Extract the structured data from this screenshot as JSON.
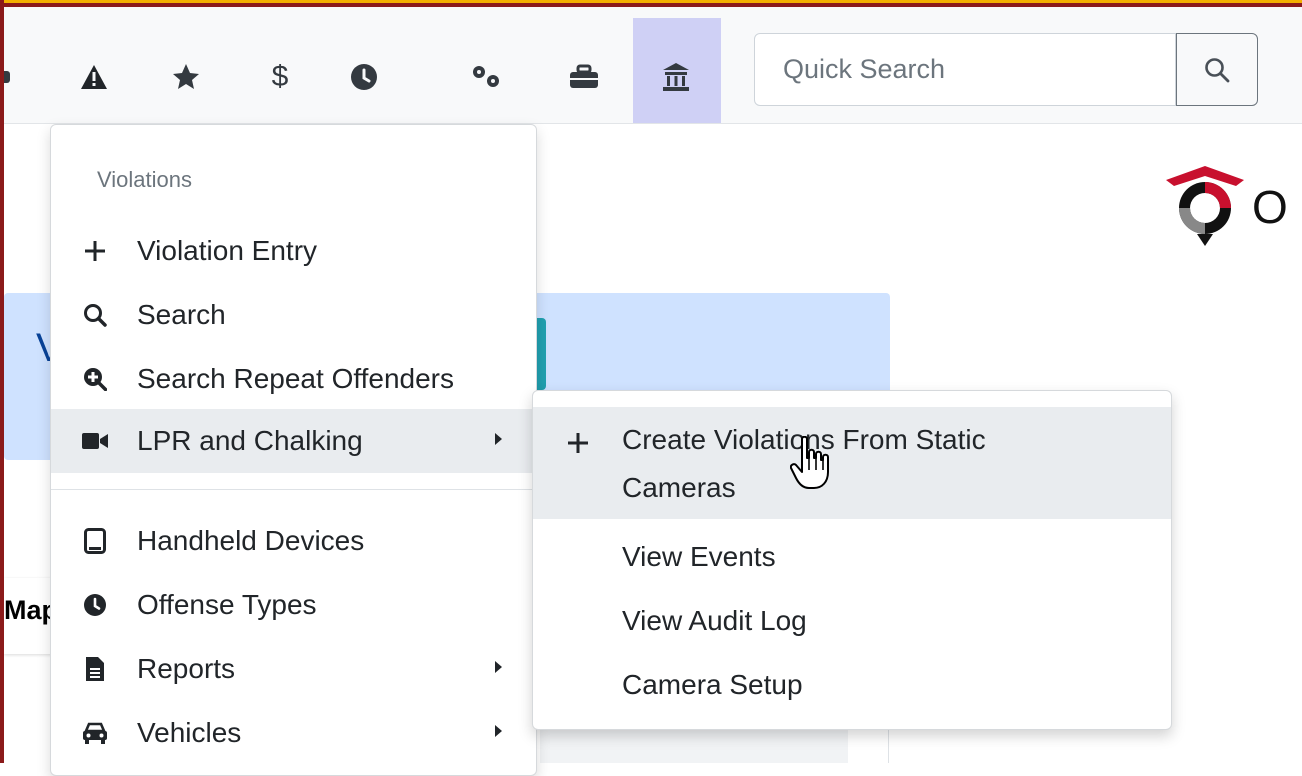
{
  "nav": {
    "icons": [
      "car-icon",
      "warning-icon",
      "star-icon",
      "dollar-icon",
      "clock-icon",
      "cogs-icon",
      "toolbox-icon",
      "gavel-building-icon"
    ],
    "dollar_label": "$",
    "search_placeholder": "Quick Search",
    "active_color": "#cfd0f5"
  },
  "background": {
    "banner_letter": "V",
    "map_label": "Map",
    "logo_letter": "O"
  },
  "menu": {
    "header": "Violations",
    "items": [
      {
        "label": "Violation Entry",
        "icon": "plus-icon"
      },
      {
        "label": "Search",
        "icon": "search-icon"
      },
      {
        "label": "Search Repeat Offenders",
        "icon": "search-plus-icon"
      },
      {
        "label": "LPR and Chalking",
        "icon": "video-camera-icon",
        "has_submenu": true,
        "active": true
      },
      {
        "label": "Handheld Devices",
        "icon": "tablet-icon"
      },
      {
        "label": "Offense Types",
        "icon": "clock-icon"
      },
      {
        "label": "Reports",
        "icon": "file-icon",
        "has_submenu": true
      },
      {
        "label": "Vehicles",
        "icon": "car-icon",
        "has_submenu": true
      }
    ]
  },
  "submenu": {
    "items": [
      {
        "label_line1": "Create Violations From Static",
        "label_line2": "Cameras",
        "icon": "plus-icon",
        "active": true
      },
      {
        "label": "View Events"
      },
      {
        "label": "View Audit Log"
      },
      {
        "label": "Camera Setup"
      }
    ]
  },
  "colors": {
    "frame_red": "#8b1a1a",
    "frame_gold": "#f3b000",
    "banner": "#cfe2ff",
    "hover": "#e9ecef"
  }
}
